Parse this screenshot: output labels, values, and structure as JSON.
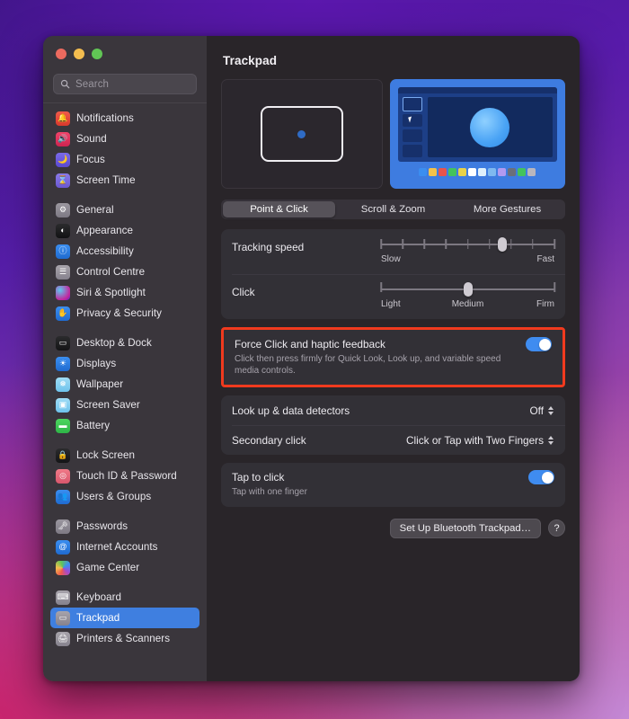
{
  "window": {
    "traffic_lights": [
      "close",
      "minimize",
      "zoom"
    ],
    "colors": {
      "close": "#ec6a5f",
      "minimize": "#f4bd4f",
      "zoom": "#61c555",
      "accent": "#3f7fe0",
      "toggle_on": "#3f8cf0",
      "highlight": "#f03a1e"
    }
  },
  "sidebar": {
    "search": {
      "placeholder": "Search",
      "value": "",
      "icon": "search-icon"
    },
    "groups": [
      {
        "items": [
          {
            "label": "Notifications",
            "icon": "bell-icon",
            "icon_bg": "linear-gradient(180deg,#f05a4a,#d8392c)",
            "glyph": "🔔"
          },
          {
            "label": "Sound",
            "icon": "speaker-icon",
            "icon_bg": "linear-gradient(180deg,#f0446a,#cf2450)",
            "glyph": "🔊"
          },
          {
            "label": "Focus",
            "icon": "moon-icon",
            "icon_bg": "linear-gradient(180deg,#7b6ae8,#5a49d0)",
            "glyph": "🌙"
          },
          {
            "label": "Screen Time",
            "icon": "hourglass-icon",
            "icon_bg": "linear-gradient(180deg,#8a7ae8,#6a58d2)",
            "glyph": "⌛"
          }
        ]
      },
      {
        "items": [
          {
            "label": "General",
            "icon": "gear-icon",
            "icon_bg": "linear-gradient(180deg,#9b979f,#7d7984)",
            "glyph": "⚙"
          },
          {
            "label": "Appearance",
            "icon": "contrast-icon",
            "icon_bg": "linear-gradient(180deg,#2b2b2d,#121214)",
            "glyph": "◐"
          },
          {
            "label": "Accessibility",
            "icon": "person-icon",
            "icon_bg": "linear-gradient(180deg,#3b8ef0,#1f6bd0)",
            "glyph": "ⓘ"
          },
          {
            "label": "Control Centre",
            "icon": "switches-icon",
            "icon_bg": "linear-gradient(180deg,#a7a3ab,#86828d)",
            "glyph": "☰"
          },
          {
            "label": "Siri & Spotlight",
            "icon": "siri-icon",
            "icon_bg": "radial-gradient(circle at 30% 30%,#5ec8f0,#c4269c 70%,#4a2bd0)",
            "glyph": ""
          },
          {
            "label": "Privacy & Security",
            "icon": "hand-icon",
            "icon_bg": "linear-gradient(180deg,#3b8ef0,#1f6bd0)",
            "glyph": "✋"
          }
        ]
      },
      {
        "items": [
          {
            "label": "Desktop & Dock",
            "icon": "dock-icon",
            "icon_bg": "linear-gradient(180deg,#2b2b2d,#141416)",
            "glyph": "▭"
          },
          {
            "label": "Displays",
            "icon": "display-icon",
            "icon_bg": "linear-gradient(180deg,#3b8ef0,#1f6bd0)",
            "glyph": "☀"
          },
          {
            "label": "Wallpaper",
            "icon": "wallpaper-icon",
            "icon_bg": "linear-gradient(180deg,#9fdcf5,#6ec3ec)",
            "glyph": "❅"
          },
          {
            "label": "Screen Saver",
            "icon": "screensaver-icon",
            "icon_bg": "linear-gradient(180deg,#9fdcf5,#6ec3ec)",
            "glyph": "▣"
          },
          {
            "label": "Battery",
            "icon": "battery-icon",
            "icon_bg": "linear-gradient(180deg,#4cd65f,#2eb547)",
            "glyph": "▬"
          }
        ]
      },
      {
        "items": [
          {
            "label": "Lock Screen",
            "icon": "lock-icon",
            "icon_bg": "linear-gradient(180deg,#2b2b2d,#141416)",
            "glyph": "🔒"
          },
          {
            "label": "Touch ID & Password",
            "icon": "touchid-icon",
            "icon_bg": "linear-gradient(180deg,#f07a88,#d8566c)",
            "glyph": "◎"
          },
          {
            "label": "Users & Groups",
            "icon": "users-icon",
            "icon_bg": "linear-gradient(180deg,#3b8ef0,#1f6bd0)",
            "glyph": "👥"
          }
        ]
      },
      {
        "items": [
          {
            "label": "Passwords",
            "icon": "key-icon",
            "icon_bg": "linear-gradient(180deg,#9b979f,#7d7984)",
            "glyph": "🗝"
          },
          {
            "label": "Internet Accounts",
            "icon": "at-icon",
            "icon_bg": "linear-gradient(180deg,#3b8ef0,#1f6bd0)",
            "glyph": "@"
          },
          {
            "label": "Game Center",
            "icon": "gamecenter-icon",
            "icon_bg": "conic-gradient(from 200deg,#f05a4a,#f4bd4f,#61c555,#3b8ef0,#a04ad0,#f05a4a)",
            "glyph": ""
          }
        ]
      },
      {
        "items": [
          {
            "label": "Keyboard",
            "icon": "keyboard-icon",
            "icon_bg": "linear-gradient(180deg,#a7a3ab,#86828d)",
            "glyph": "⌨"
          },
          {
            "label": "Trackpad",
            "icon": "trackpad-icon",
            "icon_bg": "linear-gradient(180deg,#a7a3ab,#86828d)",
            "glyph": "▭",
            "selected": true
          },
          {
            "label": "Printers & Scanners",
            "icon": "printer-icon",
            "icon_bg": "linear-gradient(180deg,#a7a3ab,#86828d)",
            "glyph": "🖨"
          }
        ]
      }
    ]
  },
  "main": {
    "title": "Trackpad",
    "preview": {
      "left_name": "trackpad-illustration",
      "right_name": "quicklook-preview-illustration",
      "swatch_colors": [
        "#3b8ef0",
        "#f3c24a",
        "#e8544b",
        "#44c35c",
        "#e8d24a",
        "#ffffff",
        "#dff0fb",
        "#7fb9ef",
        "#b29af0",
        "#6b6f7a",
        "#44c35c",
        "#b9b6bd"
      ]
    },
    "tabs": [
      {
        "label": "Point & Click",
        "active": true
      },
      {
        "label": "Scroll & Zoom",
        "active": false
      },
      {
        "label": "More Gestures",
        "active": false
      }
    ],
    "sliders": [
      {
        "label": "Tracking speed",
        "scale_left": "Slow",
        "scale_mid": "",
        "scale_right": "Fast",
        "value_percent": 70,
        "ticks": 9,
        "show_ticks": true
      },
      {
        "label": "Click",
        "scale_left": "Light",
        "scale_mid": "Medium",
        "scale_right": "Firm",
        "value_percent": 50,
        "ticks": 3,
        "show_ticks": false
      }
    ],
    "force_click": {
      "label": "Force Click and haptic feedback",
      "description": "Click then press firmly for Quick Look, Look up, and variable speed media controls.",
      "toggle_on": true,
      "highlighted": true
    },
    "popup_rows": [
      {
        "label": "Look up & data detectors",
        "value": "Off"
      },
      {
        "label": "Secondary click",
        "value": "Click or Tap with Two Fingers"
      }
    ],
    "tap_to_click": {
      "label": "Tap to click",
      "description": "Tap with one finger",
      "toggle_on": true
    },
    "footer": {
      "setup_button": "Set Up Bluetooth Trackpad…",
      "help_button": "?"
    }
  }
}
